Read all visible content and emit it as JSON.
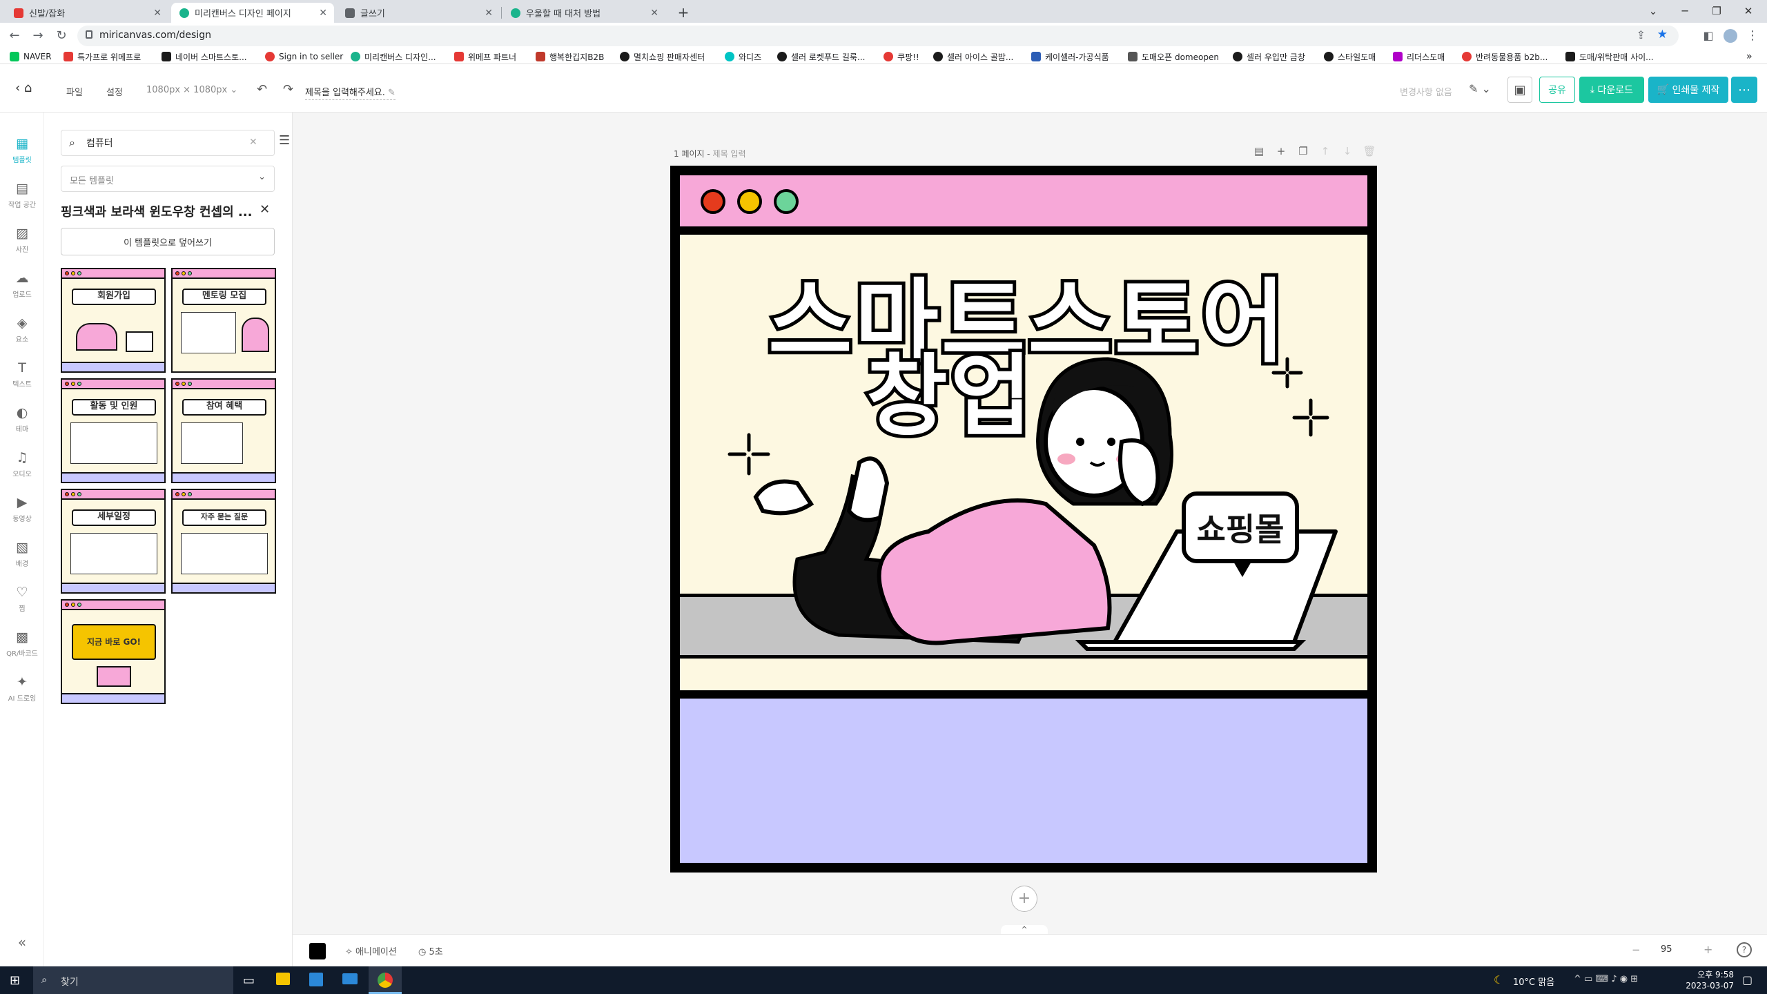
{
  "browser": {
    "tabs": [
      {
        "title": "신발/잡화",
        "color": "#e53935"
      },
      {
        "title": "미리캔버스 디자인 페이지",
        "color": "#1ab48c"
      },
      {
        "title": "글쓰기",
        "color": "#5f6368"
      },
      {
        "title": "우울할 때 대처 방법",
        "color": "#1ab48c"
      }
    ],
    "url": "miricanvas.com/design",
    "bookmarks": [
      {
        "label": "NAVER",
        "color": "#03c75a"
      },
      {
        "label": "특가프로 위메프로",
        "color": "#e53935"
      },
      {
        "label": "네이버 스마트스토...",
        "color": "#1b1b1b"
      },
      {
        "label": "Sign in to seller",
        "color": "#e53935"
      },
      {
        "label": "미리캔버스 디자인...",
        "color": "#1ab48c"
      },
      {
        "label": "위메프 파트너",
        "color": "#e53935"
      },
      {
        "label": "행복한깁지B2B",
        "color": "#c0392b"
      },
      {
        "label": "멸치쇼핑 판매자센터",
        "color": "#1b1b1b"
      },
      {
        "label": "와디즈",
        "color": "#00c4c4"
      },
      {
        "label": "셀러 로켓푸드 길룩...",
        "color": "#1b1b1b"
      },
      {
        "label": "쿠팡!!",
        "color": "#e53935"
      },
      {
        "label": "셀러 아이스 골밤...",
        "color": "#1b1b1b"
      },
      {
        "label": "케이셀러-가공식품",
        "color": "#2c5db5"
      },
      {
        "label": "도매오픈 domeopen",
        "color": "#555555"
      },
      {
        "label": "셀러 우입만 금창",
        "color": "#1b1b1b"
      },
      {
        "label": "스타일도매",
        "color": "#1b1b1b"
      },
      {
        "label": "리더스도매",
        "color": "#b000c8"
      },
      {
        "label": "반려동물용품 b2b...",
        "color": "#e53935"
      },
      {
        "label": "도매/위탁판매 사이...",
        "color": "#1b1b1b"
      }
    ]
  },
  "header": {
    "file_menu": "파일",
    "settings_menu": "설정",
    "size": "1080px × 1080px",
    "title_placeholder": "제목을 입력해주세요.",
    "no_changes": "변경사항 없음",
    "share_label": "공유",
    "download_label": "다운로드",
    "print_label": "인쇄물 제작",
    "accent_teal": "#1ab4c8",
    "accent_green": "#1cc7a0"
  },
  "rail": [
    {
      "label": "템플릿",
      "icon": "template-icon"
    },
    {
      "label": "작업 공간",
      "icon": "workspace-icon"
    },
    {
      "label": "사진",
      "icon": "photo-icon"
    },
    {
      "label": "업로드",
      "icon": "upload-icon"
    },
    {
      "label": "요소",
      "icon": "elements-icon"
    },
    {
      "label": "텍스트",
      "icon": "text-icon"
    },
    {
      "label": "테마",
      "icon": "theme-icon"
    },
    {
      "label": "오디오",
      "icon": "audio-icon"
    },
    {
      "label": "동영상",
      "icon": "video-icon"
    },
    {
      "label": "배경",
      "icon": "background-icon"
    },
    {
      "label": "찜",
      "icon": "heart-icon"
    },
    {
      "label": "QR/바코드",
      "icon": "qr-icon"
    },
    {
      "label": "AI 드로잉",
      "icon": "ai-drawing-icon"
    }
  ],
  "panel": {
    "search_value": "컴퓨터",
    "filter_value": "모든 템플릿",
    "template_title": "핑크색과 보라색 윈도우창 컨셉의 ...",
    "overwrite_label": "이 템플릿으로 덮어쓰기",
    "thumbs": [
      {
        "title": "회원가입"
      },
      {
        "title": "멘토링 모집"
      },
      {
        "title": "활동 및 인원"
      },
      {
        "title": "참여 혜택"
      },
      {
        "title": "세부일정"
      },
      {
        "title": "자주 묻는 질문"
      },
      {
        "title": "지금 바로 GO!"
      }
    ]
  },
  "canvas": {
    "page_label": "1 페이지",
    "page_title_placeholder": "제목 입력",
    "headline1": "스마트스토어",
    "headline2": "창업",
    "bubble_text": "쇼핑몰",
    "colors": {
      "pink": "#f7a8d8",
      "cream": "#fdf8e1",
      "lavender": "#c8c8ff",
      "red": "#e53b1d",
      "yellow": "#f5c400",
      "green": "#6cd49a"
    }
  },
  "bottombar": {
    "animation_label": "애니메이션",
    "time_label": "5초",
    "zoom": "95"
  },
  "taskbar": {
    "search_placeholder": "찾기",
    "weather": "10°C 맑음",
    "time": "오후 9:58",
    "date": "2023-03-07"
  }
}
